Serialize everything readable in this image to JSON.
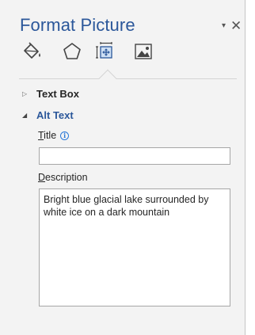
{
  "pane": {
    "title": "Format Picture",
    "dropdown_glyph": "▾",
    "close_glyph": "✕",
    "accent_color": "#2b579a"
  },
  "tabs": [
    {
      "name": "fill-line",
      "icon": "paint-bucket-icon"
    },
    {
      "name": "effects",
      "icon": "pentagon-icon"
    },
    {
      "name": "size-properties",
      "icon": "size-layout-icon",
      "selected": true
    },
    {
      "name": "picture",
      "icon": "picture-icon"
    }
  ],
  "sections": {
    "text_box": {
      "label": "Text Box",
      "expanded": false,
      "arrow": "▷"
    },
    "alt_text": {
      "label": "Alt Text",
      "expanded": true,
      "arrow": "◢"
    }
  },
  "alt_text": {
    "title_label_first": "T",
    "title_label_rest": "itle",
    "info_glyph": "i",
    "title_value": "",
    "description_label_first": "D",
    "description_label_rest": "escription",
    "description_value": "Bright blue glacial lake surrounded by white ice on a dark mountain"
  }
}
